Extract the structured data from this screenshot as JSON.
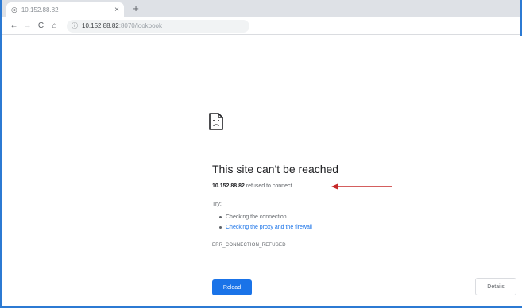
{
  "tab": {
    "favicon": "globe-icon",
    "title": "10.152.88.82",
    "close": "×",
    "new_tab": "+"
  },
  "toolbar": {
    "back": "←",
    "forward": "→",
    "reload": "C",
    "home": "⌂",
    "address_host": "10.152.88.82",
    "address_path": ":8070/lookbook"
  },
  "error": {
    "heading": "This site can't be reached",
    "host": "10.152.88.82",
    "message": " refused to connect.",
    "try_label": "Try:",
    "suggestions": [
      "Checking the connection",
      "Checking the proxy and the firewall"
    ],
    "code": "ERR_CONNECTION_REFUSED"
  },
  "buttons": {
    "reload": "Reload",
    "details": "Details"
  },
  "colors": {
    "accent": "#1a73e8",
    "annotation_arrow": "#c62828"
  }
}
